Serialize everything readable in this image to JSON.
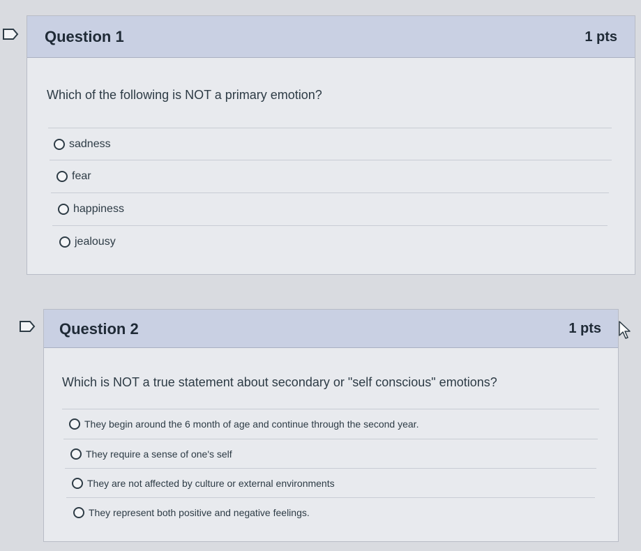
{
  "questions": [
    {
      "title": "Question 1",
      "points": "1 pts",
      "prompt": "Which of the following is NOT a primary emotion?",
      "answers": [
        "sadness",
        "fear",
        "happiness",
        "jealousy"
      ]
    },
    {
      "title": "Question 2",
      "points": "1 pts",
      "prompt": "Which is NOT a true statement about secondary or \"self conscious\" emotions?",
      "answers": [
        "They begin around the 6 month of age and continue through the second year.",
        "They require a sense of one's self",
        "They are not affected by culture or external environments",
        "They represent both positive and negative feelings."
      ]
    }
  ],
  "icons": {
    "flag": "bookmark-flag-icon",
    "cursor": "mouse-pointer-icon"
  }
}
